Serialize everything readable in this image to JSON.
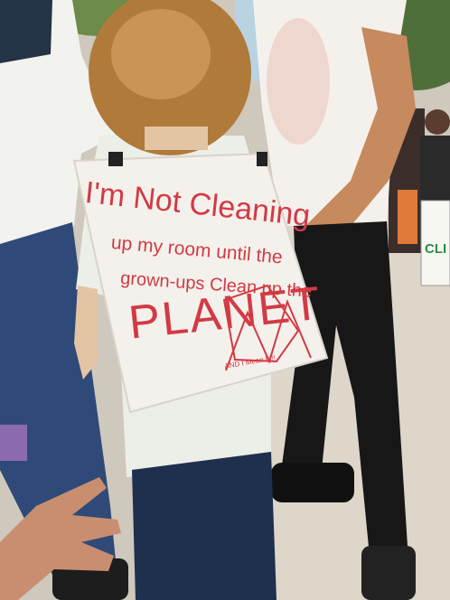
{
  "photo": {
    "subject": "protest-sign-on-child",
    "colors": {
      "sign_paper": "#f4f1ec",
      "marker_red": "#d23a44",
      "hair": "#b07a3a",
      "jeans": "#263a5c",
      "ground": "#cfc8bc"
    }
  },
  "sign": {
    "line1": "I'm Not Cleaning",
    "line2": "up my room until the",
    "line3": "grown-ups Clean up the",
    "line4": "PLANET",
    "line5": "AND I Mean It!!!"
  },
  "background_sign": {
    "text": "CLI"
  }
}
